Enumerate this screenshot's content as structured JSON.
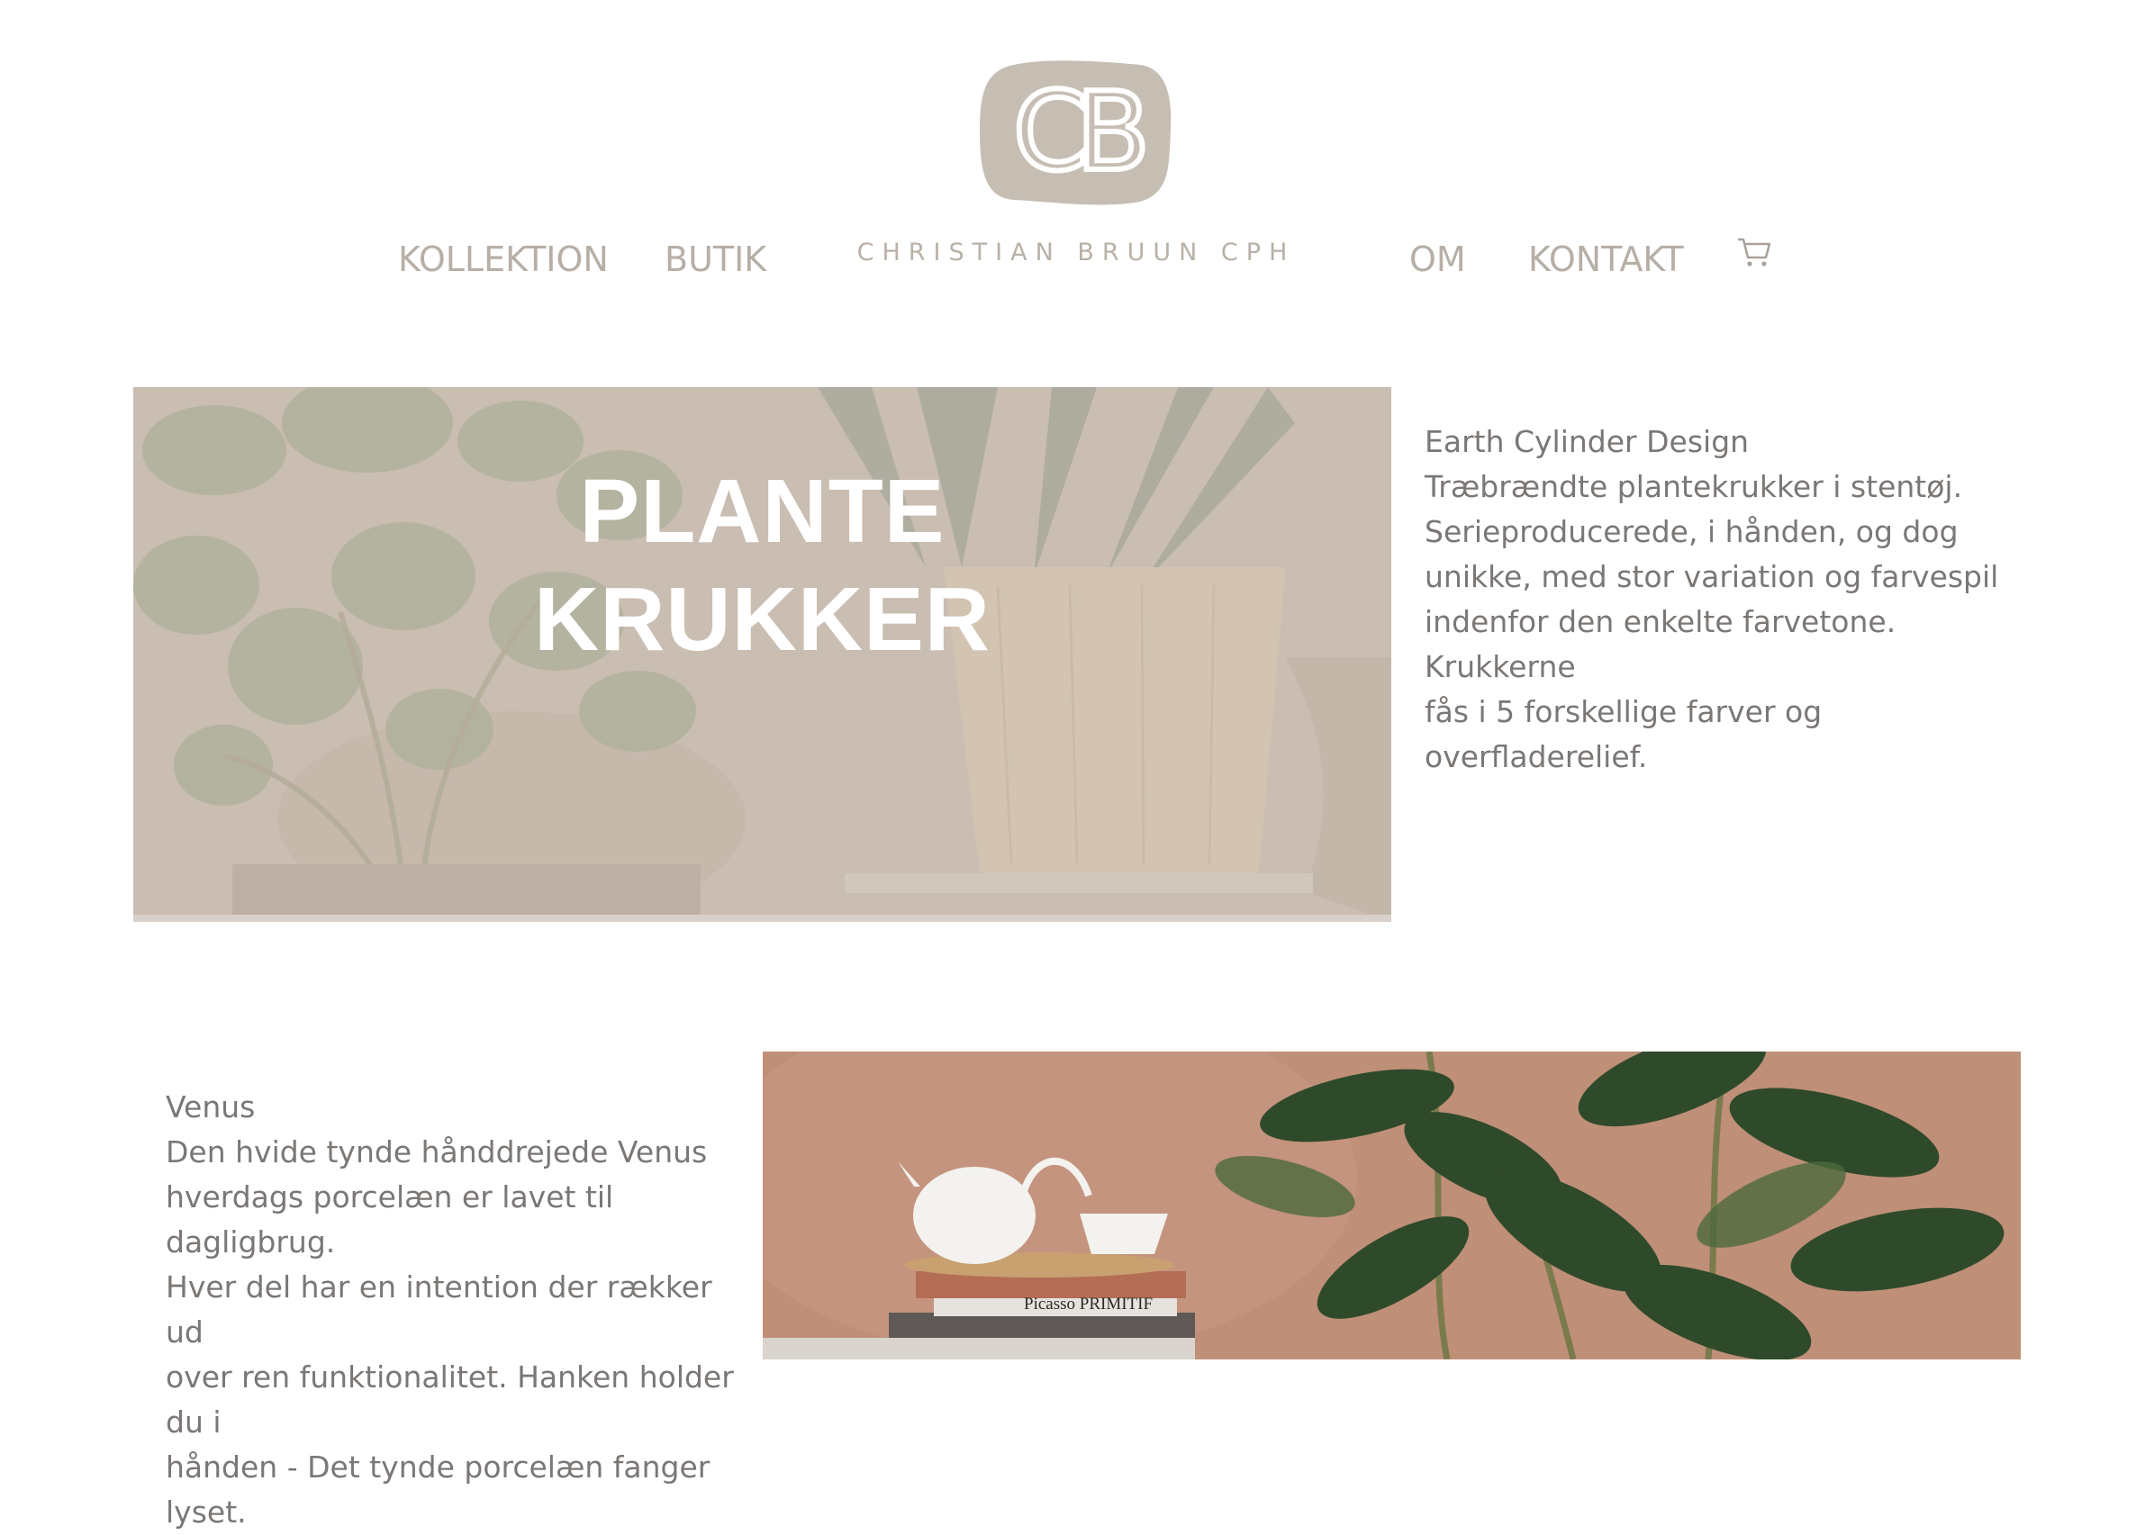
{
  "brand": {
    "name": "CHRISTIAN BRUUN CPH",
    "logo_letters": "CB"
  },
  "nav": {
    "left": [
      "KOLLEKTION",
      "BUTIK"
    ],
    "right": [
      "OM",
      "KONTAKT"
    ],
    "cart_icon": "cart-icon"
  },
  "hero": {
    "title_line1": "PLANTE",
    "title_line2": "KRUKKER"
  },
  "section1": {
    "heading": "Earth Cylinder Design",
    "lines": [
      "Træbrændte plantekrukker i stentøj.",
      "Serieproducerede, i hånden, og dog",
      "unikke, med stor variation og farvespil",
      "indenfor den enkelte farvetone. Krukkerne",
      "fås i 5 forskellige farver og overfladerelief."
    ]
  },
  "section2": {
    "heading": "Venus",
    "lines": [
      "Den hvide tynde hånddrejede Venus",
      "hverdags porcelæn er lavet til dagligbrug.",
      "Hver del har en intention der rækker ud",
      "over ren funktionalitet. Hanken holder du i",
      "hånden - Det tynde porcelæn fanger lyset."
    ],
    "book_title": "Picasso PRIMITIF"
  },
  "colors": {
    "text_muted": "#7b7775",
    "nav": "#b7afa6",
    "logo": "#c6beb3",
    "hero_bg": "#cbbfb2",
    "terracotta": "#bf8f78"
  }
}
